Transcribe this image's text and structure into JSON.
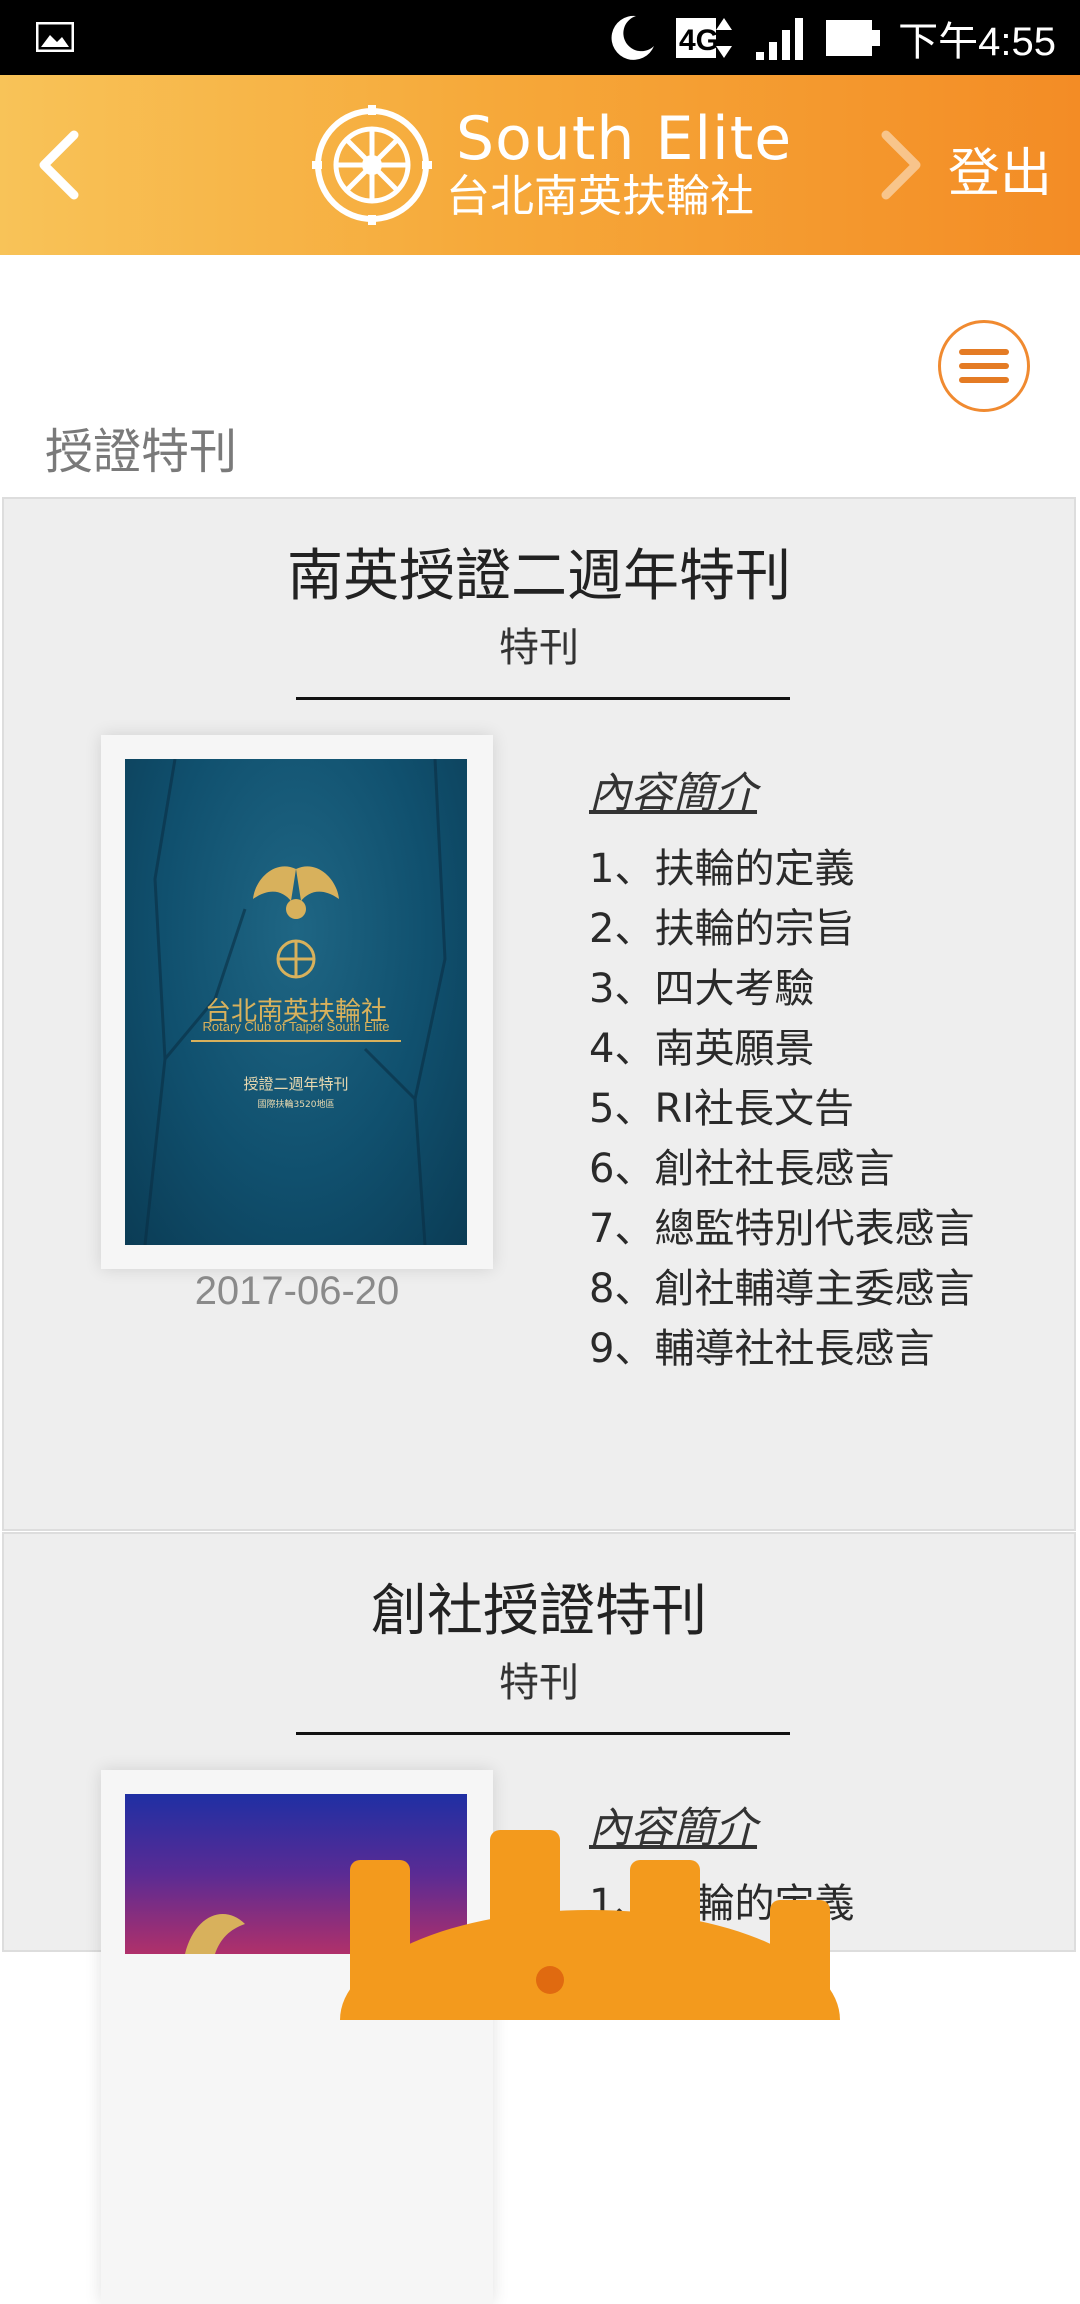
{
  "status_bar": {
    "time": "下午4:55",
    "icons": [
      "gallery-icon",
      "moon-icon",
      "4g-icon",
      "signal-icon",
      "battery-icon"
    ],
    "network": "4G"
  },
  "header": {
    "brand_en": "South Elite",
    "brand_zh": "台北南英扶輪社",
    "logout_label": "登出",
    "colors": {
      "gradient_start": "#f8c358",
      "gradient_end": "#f38c25"
    }
  },
  "page": {
    "title": "授證特刊"
  },
  "cards": [
    {
      "title": "南英授證二週年特刊",
      "subtitle": "特刊",
      "date": "2017-06-20",
      "cover": {
        "club_zh": "台北南英扶輪社",
        "club_en": "Rotary Club of Taipei South Elite",
        "edition": "授證二週年特刊",
        "district": "國際扶輪3520地區"
      },
      "toc_heading": "內容簡介",
      "toc": [
        "1、扶輪的定義",
        "2、扶輪的宗旨",
        "3、四大考驗",
        "4、南英願景",
        "5、RI社長文告",
        "6、創社社長感言",
        "7、總監特別代表感言",
        "8、創社輔導主委感言",
        "9、輔導社社長感言"
      ]
    },
    {
      "title": "創社授證特刊",
      "subtitle": "特刊",
      "toc_heading": "內容簡介",
      "toc": [
        "1、扶輪的定義"
      ]
    }
  ]
}
